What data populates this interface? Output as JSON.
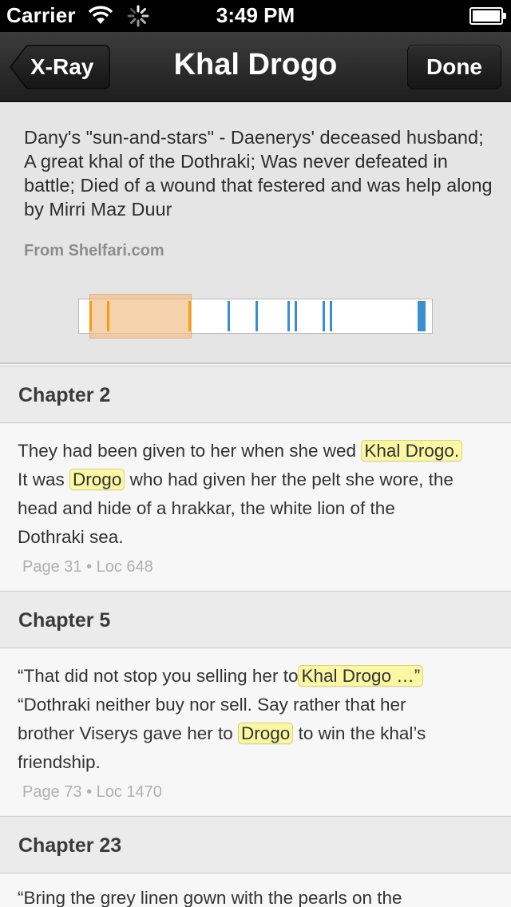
{
  "status": {
    "carrier": "Carrier",
    "time": "3:49 PM"
  },
  "nav": {
    "back_label": "X-Ray",
    "title": "Khal Drogo",
    "done_label": "Done"
  },
  "info": {
    "description": "Dany's \"sun-and-stars\" - Daenerys' deceased husband; A great khal of the Dothraki; Was never defeated in battle; Died of a wound that festered and was help along by Mirri Maz Duur",
    "source": "From Shelfari.com"
  },
  "timeline": {
    "viewport_start": 0.03,
    "viewport_end": 0.32,
    "orange_marks": [
      0.03,
      0.08,
      0.31
    ],
    "blue_marks": [
      0.42,
      0.5,
      0.59,
      0.61,
      0.69,
      0.71,
      0.96
    ],
    "colors": {
      "orange": "#f39c12",
      "blue": "#3a8fd1"
    }
  },
  "passages": [
    {
      "chapter": "Chapter 2",
      "line1_pre": "They had been given to her when she wed",
      "line1_hl": "Khal Drogo.",
      "line2_pre": "It was",
      "line2_hl": "Drogo",
      "line2_post": "who had given her the pelt she wore, the",
      "line3": "head and hide of a hrakkar, the white lion of the",
      "line4": "Dothraki sea.",
      "location": "Page 31 • Loc 648"
    },
    {
      "chapter": "Chapter 5",
      "line1_pre": "“That did not stop you selling her to",
      "line1_hl": "Khal Drogo …”",
      "line2": "“Dothraki neither buy nor sell. Say rather that her",
      "line3_pre": "brother Viserys gave her to",
      "line3_hl": "Drogo",
      "line3_post": "to win the khal’s",
      "line4": "friendship.",
      "location": "Page 73 • Loc 1470"
    },
    {
      "chapter": "Chapter 23",
      "line1": "“Bring the grey linen gown with the pearls on the"
    }
  ]
}
